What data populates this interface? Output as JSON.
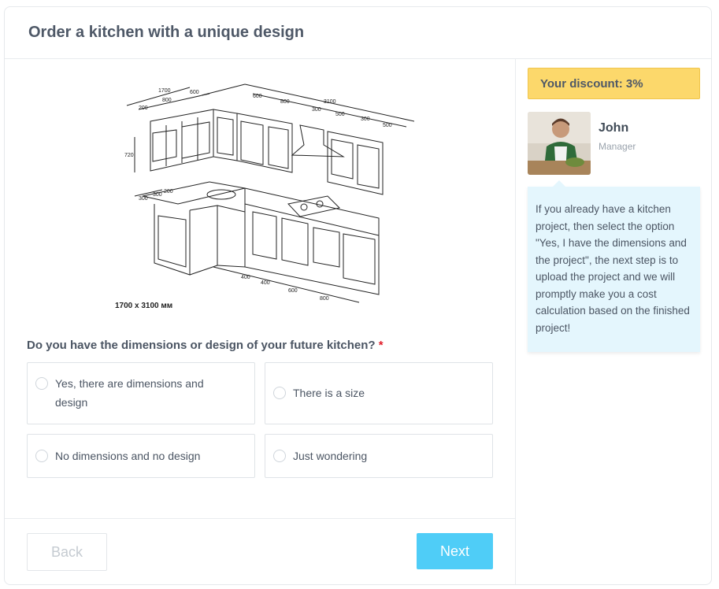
{
  "header": {
    "title": "Order a kitchen with a unique design"
  },
  "image": {
    "caption": "1700 x 3100 мм",
    "dims_top": [
      "1700",
      "200",
      "800",
      "600",
      "600",
      "800",
      "3100",
      "300",
      "500",
      "300",
      "500"
    ],
    "dims_side": [
      "720"
    ],
    "dims_bottom": [
      "300",
      "300",
      "200",
      "400",
      "400",
      "600",
      "800"
    ]
  },
  "question": {
    "text": "Do you have the dimensions or design of your future kitchen?",
    "required_mark": "*"
  },
  "options": [
    {
      "line1": "Yes, there are dimensions and",
      "line2": "design"
    },
    {
      "line1": "There is a size"
    },
    {
      "line1": "No dimensions and no design"
    },
    {
      "line1": "Just wondering"
    }
  ],
  "buttons": {
    "back": "Back",
    "next": "Next"
  },
  "sidebar": {
    "discount": "Your discount: 3%",
    "manager_name": "John",
    "manager_role": "Manager",
    "message": "If you already have a kitchen project, then select the option \"Yes, I have the dimensions and the project\", the next step is to upload the project and we will promptly make you a cost calculation based on the finished project!"
  },
  "colors": {
    "accent": "#4fcdf7",
    "discount_bg": "#fcd86b",
    "bubble_bg": "#e4f6fd",
    "required": "#e11d2a"
  }
}
